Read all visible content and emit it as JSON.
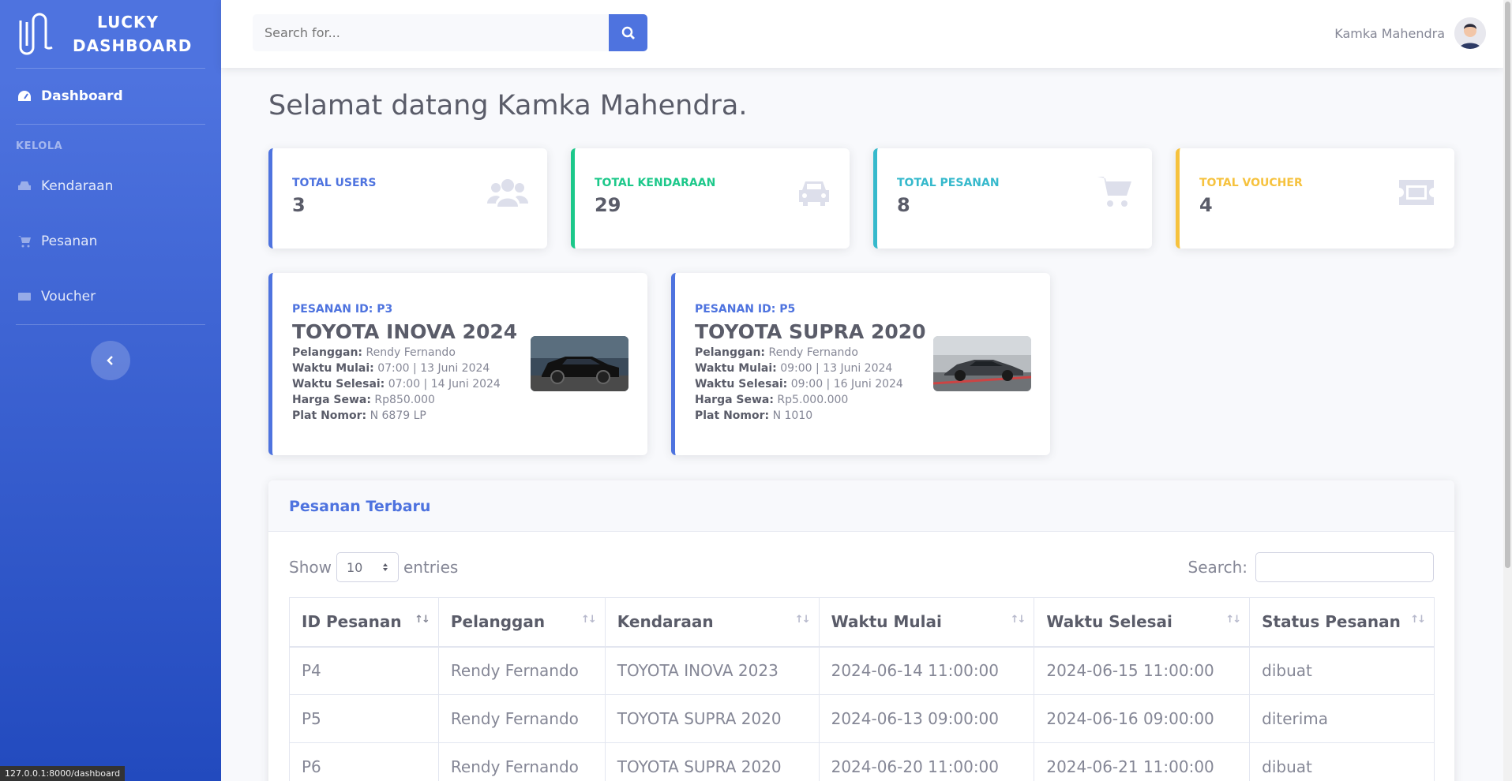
{
  "brand": {
    "line1": "LUCKY",
    "line2": "DASHBOARD"
  },
  "sidebar": {
    "dashboard": "Dashboard",
    "heading": "KELOLA",
    "items": [
      {
        "label": "Kendaraan",
        "icon": "car-icon"
      },
      {
        "label": "Pesanan",
        "icon": "cart-icon"
      },
      {
        "label": "Voucher",
        "icon": "ticket-icon"
      }
    ]
  },
  "topbar": {
    "search_placeholder": "Search for...",
    "user_name": "Kamka Mahendra"
  },
  "main": {
    "title": "Selamat datang Kamka Mahendra.",
    "stats": [
      {
        "label": "TOTAL USERS",
        "value": "3",
        "color": "#4e73df",
        "icon": "users-icon"
      },
      {
        "label": "TOTAL KENDARAAN",
        "value": "29",
        "color": "#1cc88a",
        "icon": "car-icon"
      },
      {
        "label": "TOTAL PESANAN",
        "value": "8",
        "color": "#36b9cc",
        "icon": "cart-icon"
      },
      {
        "label": "TOTAL VOUCHER",
        "value": "4",
        "color": "#f6c23e",
        "icon": "ticket-icon"
      }
    ],
    "orders": [
      {
        "id": "PESANAN ID: P3",
        "vehicle": "TOYOTA INOVA 2024",
        "pelanggan_label": "Pelanggan:",
        "pelanggan": "Rendy Fernando",
        "mulai_label": "Waktu Mulai:",
        "mulai": "07:00 | 13 Juni 2024",
        "selesai_label": "Waktu Selesai:",
        "selesai": "07:00 | 14 Juni 2024",
        "harga_label": "Harga Sewa:",
        "harga": "Rp850.000",
        "plat_label": "Plat Nomor:",
        "plat": "N 6879 LP"
      },
      {
        "id": "PESANAN ID: P5",
        "vehicle": "TOYOTA SUPRA 2020",
        "pelanggan_label": "Pelanggan:",
        "pelanggan": "Rendy Fernando",
        "mulai_label": "Waktu Mulai:",
        "mulai": "09:00 | 13 Juni 2024",
        "selesai_label": "Waktu Selesai:",
        "selesai": "09:00 | 16 Juni 2024",
        "harga_label": "Harga Sewa:",
        "harga": "Rp5.000.000",
        "plat_label": "Plat Nomor:",
        "plat": "N 1010"
      }
    ],
    "table": {
      "title": "Pesanan Terbaru",
      "show_label": "Show",
      "entries_value": "10",
      "entries_label": "entries",
      "search_label": "Search:",
      "columns": [
        "ID Pesanan",
        "Pelanggan",
        "Kendaraan",
        "Waktu Mulai",
        "Waktu Selesai",
        "Status Pesanan"
      ],
      "rows": [
        [
          "P4",
          "Rendy Fernando",
          "TOYOTA INOVA 2023",
          "2024-06-14 11:00:00",
          "2024-06-15 11:00:00",
          "dibuat"
        ],
        [
          "P5",
          "Rendy Fernando",
          "TOYOTA SUPRA 2020",
          "2024-06-13 09:00:00",
          "2024-06-16 09:00:00",
          "diterima"
        ],
        [
          "P6",
          "Rendy Fernando",
          "TOYOTA SUPRA 2020",
          "2024-06-20 11:00:00",
          "2024-06-21 11:00:00",
          "dibuat"
        ]
      ]
    }
  },
  "statusbar": {
    "url": "127.0.0.1:8000/dashboard"
  }
}
